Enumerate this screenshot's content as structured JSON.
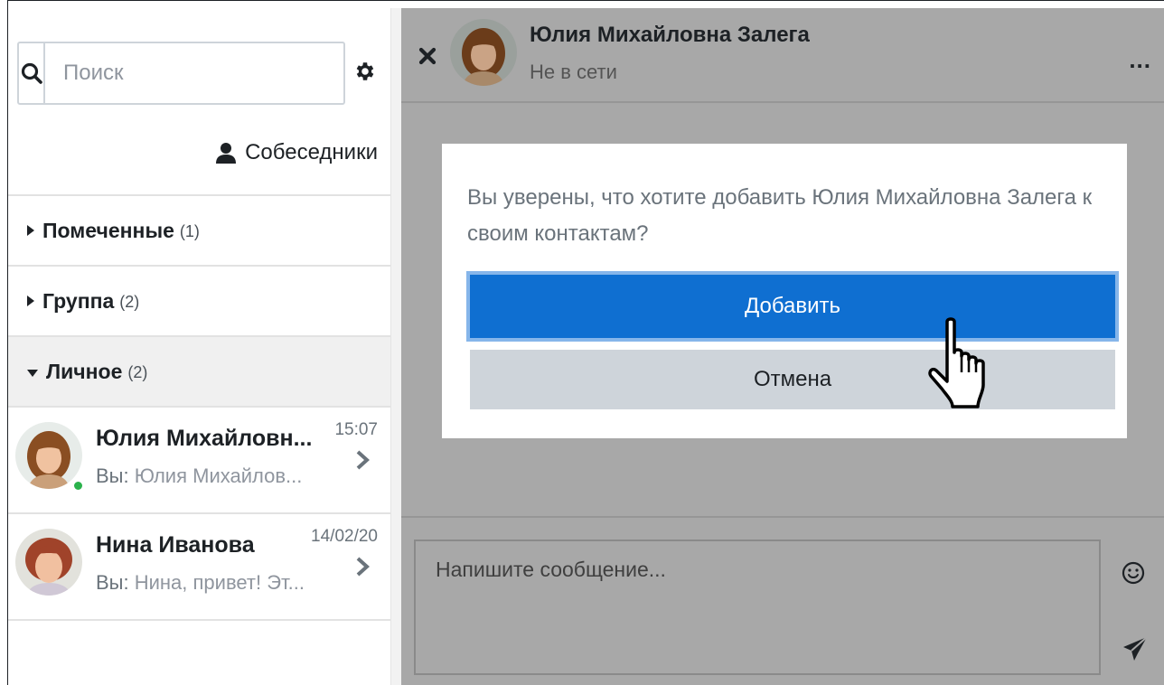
{
  "search": {
    "placeholder": "Поиск"
  },
  "contacts_link": {
    "label": "Собеседники"
  },
  "sections": [
    {
      "name": "Помеченные",
      "count": "(1)",
      "expanded": false
    },
    {
      "name": "Группа",
      "count": "(2)",
      "expanded": false
    },
    {
      "name": "Личное",
      "count": "(2)",
      "expanded": true
    }
  ],
  "conversations": [
    {
      "name": "Юлия Михайловн...",
      "time": "15:07",
      "you": "Вы:",
      "preview": "Юлия Михайлов...",
      "online": true
    },
    {
      "name": "Нина Иванова",
      "time": "14/02/20",
      "you": "Вы:",
      "preview": "Нина, привет! Эт...",
      "online": false
    }
  ],
  "header": {
    "name": "Юлия Михайловна Залега",
    "status": "Не в сети",
    "more": "..."
  },
  "dialog": {
    "message": "Вы уверены, что хотите добавить Юлия Михайловна Залега к своим контактам?",
    "confirm_label": "Добавить",
    "cancel_label": "Отмена"
  },
  "composer": {
    "placeholder": "Напишите сообщение..."
  },
  "colors": {
    "primary": "#0f6fd1",
    "online": "#2bb24c",
    "overlay": "#a8a8a8",
    "secondary": "#ced4da"
  }
}
